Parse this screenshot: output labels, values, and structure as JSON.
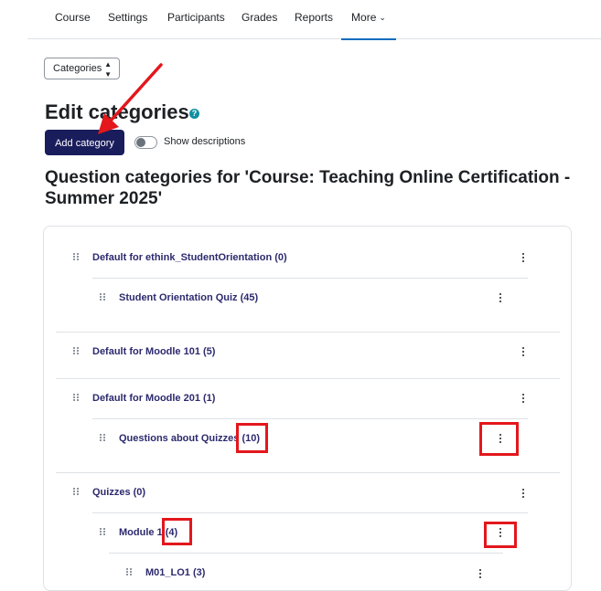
{
  "nav": {
    "items": [
      "Course",
      "Settings",
      "Participants",
      "Grades",
      "Reports",
      "More"
    ]
  },
  "category_select": {
    "value": "Categories"
  },
  "title": "Edit categories",
  "add_button": "Add category",
  "show_descriptions": "Show descriptions",
  "heading": "Question categories for 'Course: Teaching Online Certification - Summer 2025'",
  "categories": [
    {
      "label": "Default for ethink_StudentOrientation (0)",
      "level": 0
    },
    {
      "label": "Student Orientation Quiz (45)",
      "level": 1
    },
    {
      "label": "Default for Moodle 101 (5)",
      "level": 0
    },
    {
      "label": "Default for Moodle 201 (1)",
      "level": 0
    },
    {
      "label": "Questions about Quizzes (10)",
      "level": 1
    },
    {
      "label": "Quizzes (0)",
      "level": 0
    },
    {
      "label": "Module 1 (4)",
      "level": 1
    },
    {
      "label": "M01_LO1 (3)",
      "level": 2
    }
  ],
  "colors": {
    "accent": "#1a1d5c",
    "annotation": "#e3171c",
    "link": "#2c2a6e"
  }
}
